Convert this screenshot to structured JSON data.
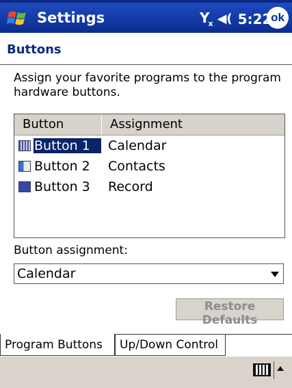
{
  "titlebar": {
    "app_title": "Settings",
    "time": "5:22",
    "ok_label": "ok"
  },
  "page": {
    "section_title": "Buttons",
    "description": "Assign your favorite programs to the program hardware buttons."
  },
  "list": {
    "headers": [
      "Button",
      "Assignment"
    ],
    "rows": [
      {
        "button": "Button 1",
        "assignment": "Calendar",
        "icon": "calendar-app-icon",
        "selected": true
      },
      {
        "button": "Button 2",
        "assignment": "Contacts",
        "icon": "contacts-app-icon",
        "selected": false
      },
      {
        "button": "Button 3",
        "assignment": "Record",
        "icon": "record-app-icon",
        "selected": false
      }
    ]
  },
  "assignment": {
    "label": "Button assignment:",
    "value": "Calendar"
  },
  "restore_label": "Restore Defaults",
  "tabs": [
    "Program Buttons",
    "Up/Down Control"
  ],
  "colors": {
    "titlebar": "#0a2c8f",
    "section_title": "#0b2a86",
    "selection": "#0a246a",
    "gray_bar": "#d9d3cb"
  }
}
